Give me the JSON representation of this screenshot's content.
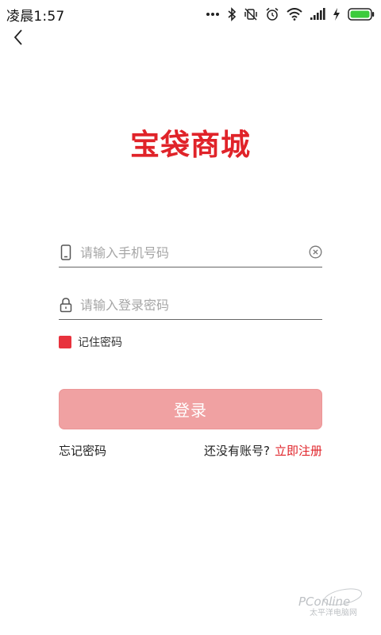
{
  "status_bar": {
    "time": "凌晨1:57",
    "icons": [
      "more-dots-icon",
      "bluetooth-icon",
      "vibrate-off-icon",
      "alarm-icon",
      "wifi-icon",
      "signal-icon",
      "charging-icon",
      "battery-icon"
    ],
    "battery_level": 1.0,
    "battery_color": "#3ccb3c"
  },
  "nav": {
    "back_icon": "chevron-left-icon"
  },
  "logo": {
    "text": "宝袋商城",
    "brand_color": "#e02329",
    "dot_color": "#f5b41c"
  },
  "form": {
    "phone": {
      "icon": "phone-icon",
      "value": "",
      "placeholder": "请输入手机号码",
      "clear_icon": "clear-circle-icon"
    },
    "password": {
      "icon": "lock-icon",
      "value": "",
      "placeholder": "请输入登录密码"
    },
    "remember": {
      "label": "记住密码",
      "checked": true,
      "color": "#e8323d"
    },
    "login_button": {
      "label": "登录",
      "color": "#f0a1a2"
    }
  },
  "links": {
    "forgot_password": "忘记密码",
    "no_account": "还没有账号?",
    "register": "立即注册",
    "register_color": "#e02329"
  },
  "watermark": {
    "brand": "PConline",
    "subtitle": "太平洋电脑网"
  }
}
